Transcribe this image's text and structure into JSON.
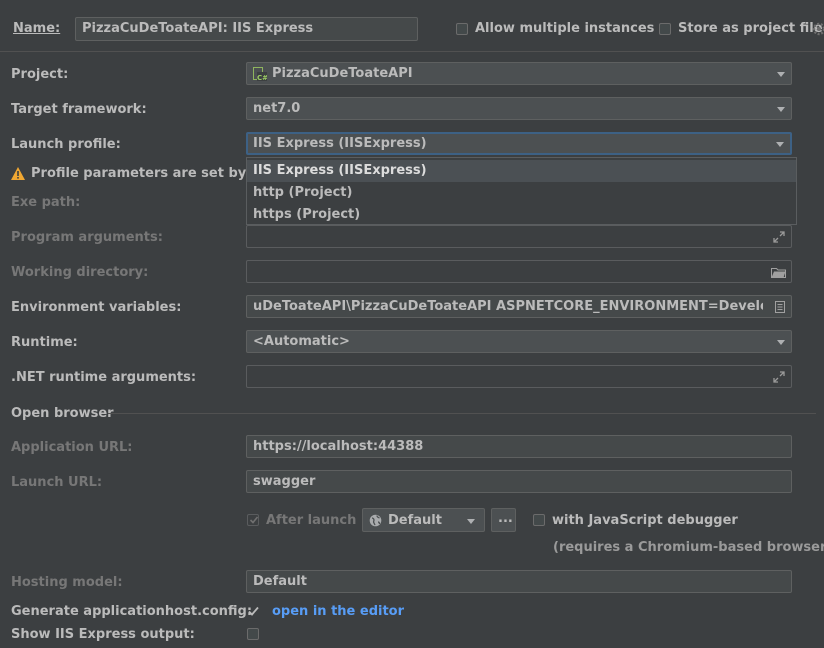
{
  "header": {
    "name_label": "Name:",
    "name_value": "PizzaCuDeToateAPI: IIS Express",
    "allow_multiple": "Allow multiple instances",
    "store_project": "Store as project file"
  },
  "form": {
    "project_label": "Project:",
    "project_value": "PizzaCuDeToateAPI",
    "framework_label": "Target framework:",
    "framework_value": "net7.0",
    "launch_profile_label": "Launch profile:",
    "launch_profile_value": "IIS Express (IISExpress)",
    "profile_warning": "Profile parameters are set by Pro",
    "exe_path_label": "Exe path:",
    "program_args_label": "Program arguments:",
    "working_dir_label": "Working directory:",
    "env_vars_label": "Environment variables:",
    "env_vars_value": "uDeToateAPI\\PizzaCuDeToateAPI ASPNETCORE_ENVIRONMENT=Development",
    "runtime_label": "Runtime:",
    "runtime_value": "<Automatic>",
    "dotnet_args_label": ".NET runtime arguments:",
    "open_browser_label": "Open browser",
    "app_url_label": "Application URL:",
    "app_url_value": "https://localhost:44388",
    "launch_url_label": "Launch URL:",
    "launch_url_value": "swagger",
    "after_launch": "After launch",
    "browser_value": "Default",
    "ellipsis": "...",
    "js_debugger": "with JavaScript debugger",
    "chromium_note": "(requires a Chromium-based browser)",
    "hosting_label": "Hosting model:",
    "hosting_value": "Default",
    "gen_config_label": "Generate applicationhost.config:",
    "open_editor_link": "open in the editor",
    "show_output_label": "Show IIS Express output:"
  },
  "dropdown": {
    "options": [
      "IIS Express (IISExpress)",
      "http (Project)",
      "https (Project)"
    ],
    "selected_index": 0
  },
  "colors": {
    "background": "#3c3f41",
    "field": "#45494a",
    "link": "#589df6",
    "warning": "#f0a732",
    "focus_border": "#3d6185"
  },
  "icons": {
    "warning": "warning-icon",
    "project": "csharp-project-icon",
    "expand": "expand-icon",
    "folder": "folder-icon",
    "document": "document-icon",
    "globe": "globe-icon",
    "gear": "gear-icon"
  }
}
